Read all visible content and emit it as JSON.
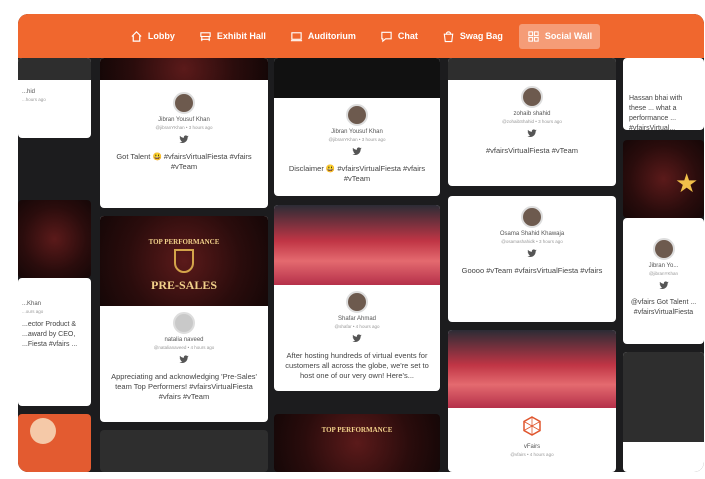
{
  "nav": {
    "items": [
      {
        "label": "Lobby",
        "icon": "home-icon"
      },
      {
        "label": "Exhibit Hall",
        "icon": "booth-icon"
      },
      {
        "label": "Auditorium",
        "icon": "screen-icon"
      },
      {
        "label": "Chat",
        "icon": "chat-icon"
      },
      {
        "label": "Swag Bag",
        "icon": "bag-icon"
      },
      {
        "label": "Social Wall",
        "icon": "grid-icon"
      }
    ],
    "active": "Social Wall",
    "color": "#f0672e"
  },
  "posts": {
    "c1_top": {
      "name": "Jibran Yousuf Khan",
      "meta": "@jibranYKhan • 3 hours ago",
      "text": "Got Talent 😃 #vfairsVirtualFiesta #vfairs #vTeam"
    },
    "c2_top": {
      "name": "Jibran Yousuf Khan",
      "meta": "@jibranYKhan • 3 hours ago",
      "text": "Disclaimer 😃 #vfairsVirtualFiesta #vfairs #vTeam"
    },
    "c3_top": {
      "name": "zohaib shahid",
      "meta": "@zohaibShahid • 3 hours ago",
      "text": "#vfairsVirtualFiesta #vTeam"
    },
    "c4_top": {
      "text": "Hassan bhai with these ... what a performance ... #vfairsVirtual..."
    },
    "c1_mid": {
      "name": "natalia naveed",
      "meta": "@natalianaveed • 4 hours ago",
      "text": "Appreciating and acknowledging 'Pre-Sales' team Top Performers! #vfairsVirtualFiesta #vfairs #vTeam",
      "banner_title": "TOP PERFORMANCE",
      "banner_sub": "PRE-SALES"
    },
    "c2_mid": {
      "name": "Shafar Ahmad",
      "meta": "@shafar • 4 hours ago",
      "text": "After hosting hundreds of virtual events for customers all across the globe, we're set to host one of our very own! Here's..."
    },
    "c3_mid": {
      "name": "Osama Shahid Khawaja",
      "meta": "@osamashahidk • 3 hours ago",
      "text": "Goooo #vTeam #vfairsVirtualFiesta #vfairs"
    },
    "c4_mid": {
      "name": "Jibran Yo...",
      "meta": "@jibranYKhan",
      "text": "@vfairs Got Talent ... #vfairsVirtualFiesta"
    },
    "c0_top": {
      "name": "...hid",
      "meta": "...hours ago",
      "text": ""
    },
    "c0_mid": {
      "name": "...Khan",
      "meta": "...ours ago",
      "text": "...ector Product & ...award by CEO, ...Fiesta #vfairs ..."
    },
    "c3_bot": {
      "name": "vFairs",
      "meta": "@vfairs • 4 hours ago"
    },
    "c2_bot": {
      "banner_title": "TOP PERFORMANCE"
    }
  }
}
